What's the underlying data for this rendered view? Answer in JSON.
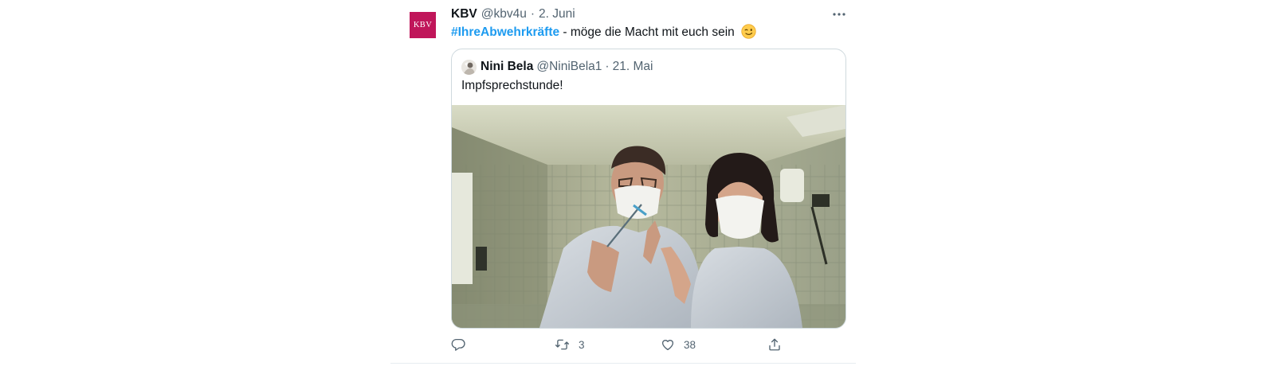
{
  "tweet": {
    "avatar_text": "KBV",
    "author_name": "KBV",
    "author_handle": "@kbv4u",
    "separator": "·",
    "date": "2. Juni",
    "hashtag": "#IhreAbwehrkräfte",
    "text": " - möge die Macht mit euch sein",
    "emoji": "wink-emoji"
  },
  "quote": {
    "author_name": "Nini Bela",
    "author_handle": "@NiniBela1",
    "separator": "·",
    "date": "21. Mai",
    "text": "Impfsprechstunde!"
  },
  "actions": {
    "reply": {
      "icon": "reply-icon",
      "count": ""
    },
    "retweet": {
      "icon": "retweet-icon",
      "count": "3"
    },
    "like": {
      "icon": "heart-icon",
      "count": "38"
    },
    "share": {
      "icon": "share-icon",
      "count": ""
    }
  },
  "colors": {
    "accent": "#1d9bf0",
    "avatar_bg": "#c0165a",
    "muted": "#536471"
  }
}
